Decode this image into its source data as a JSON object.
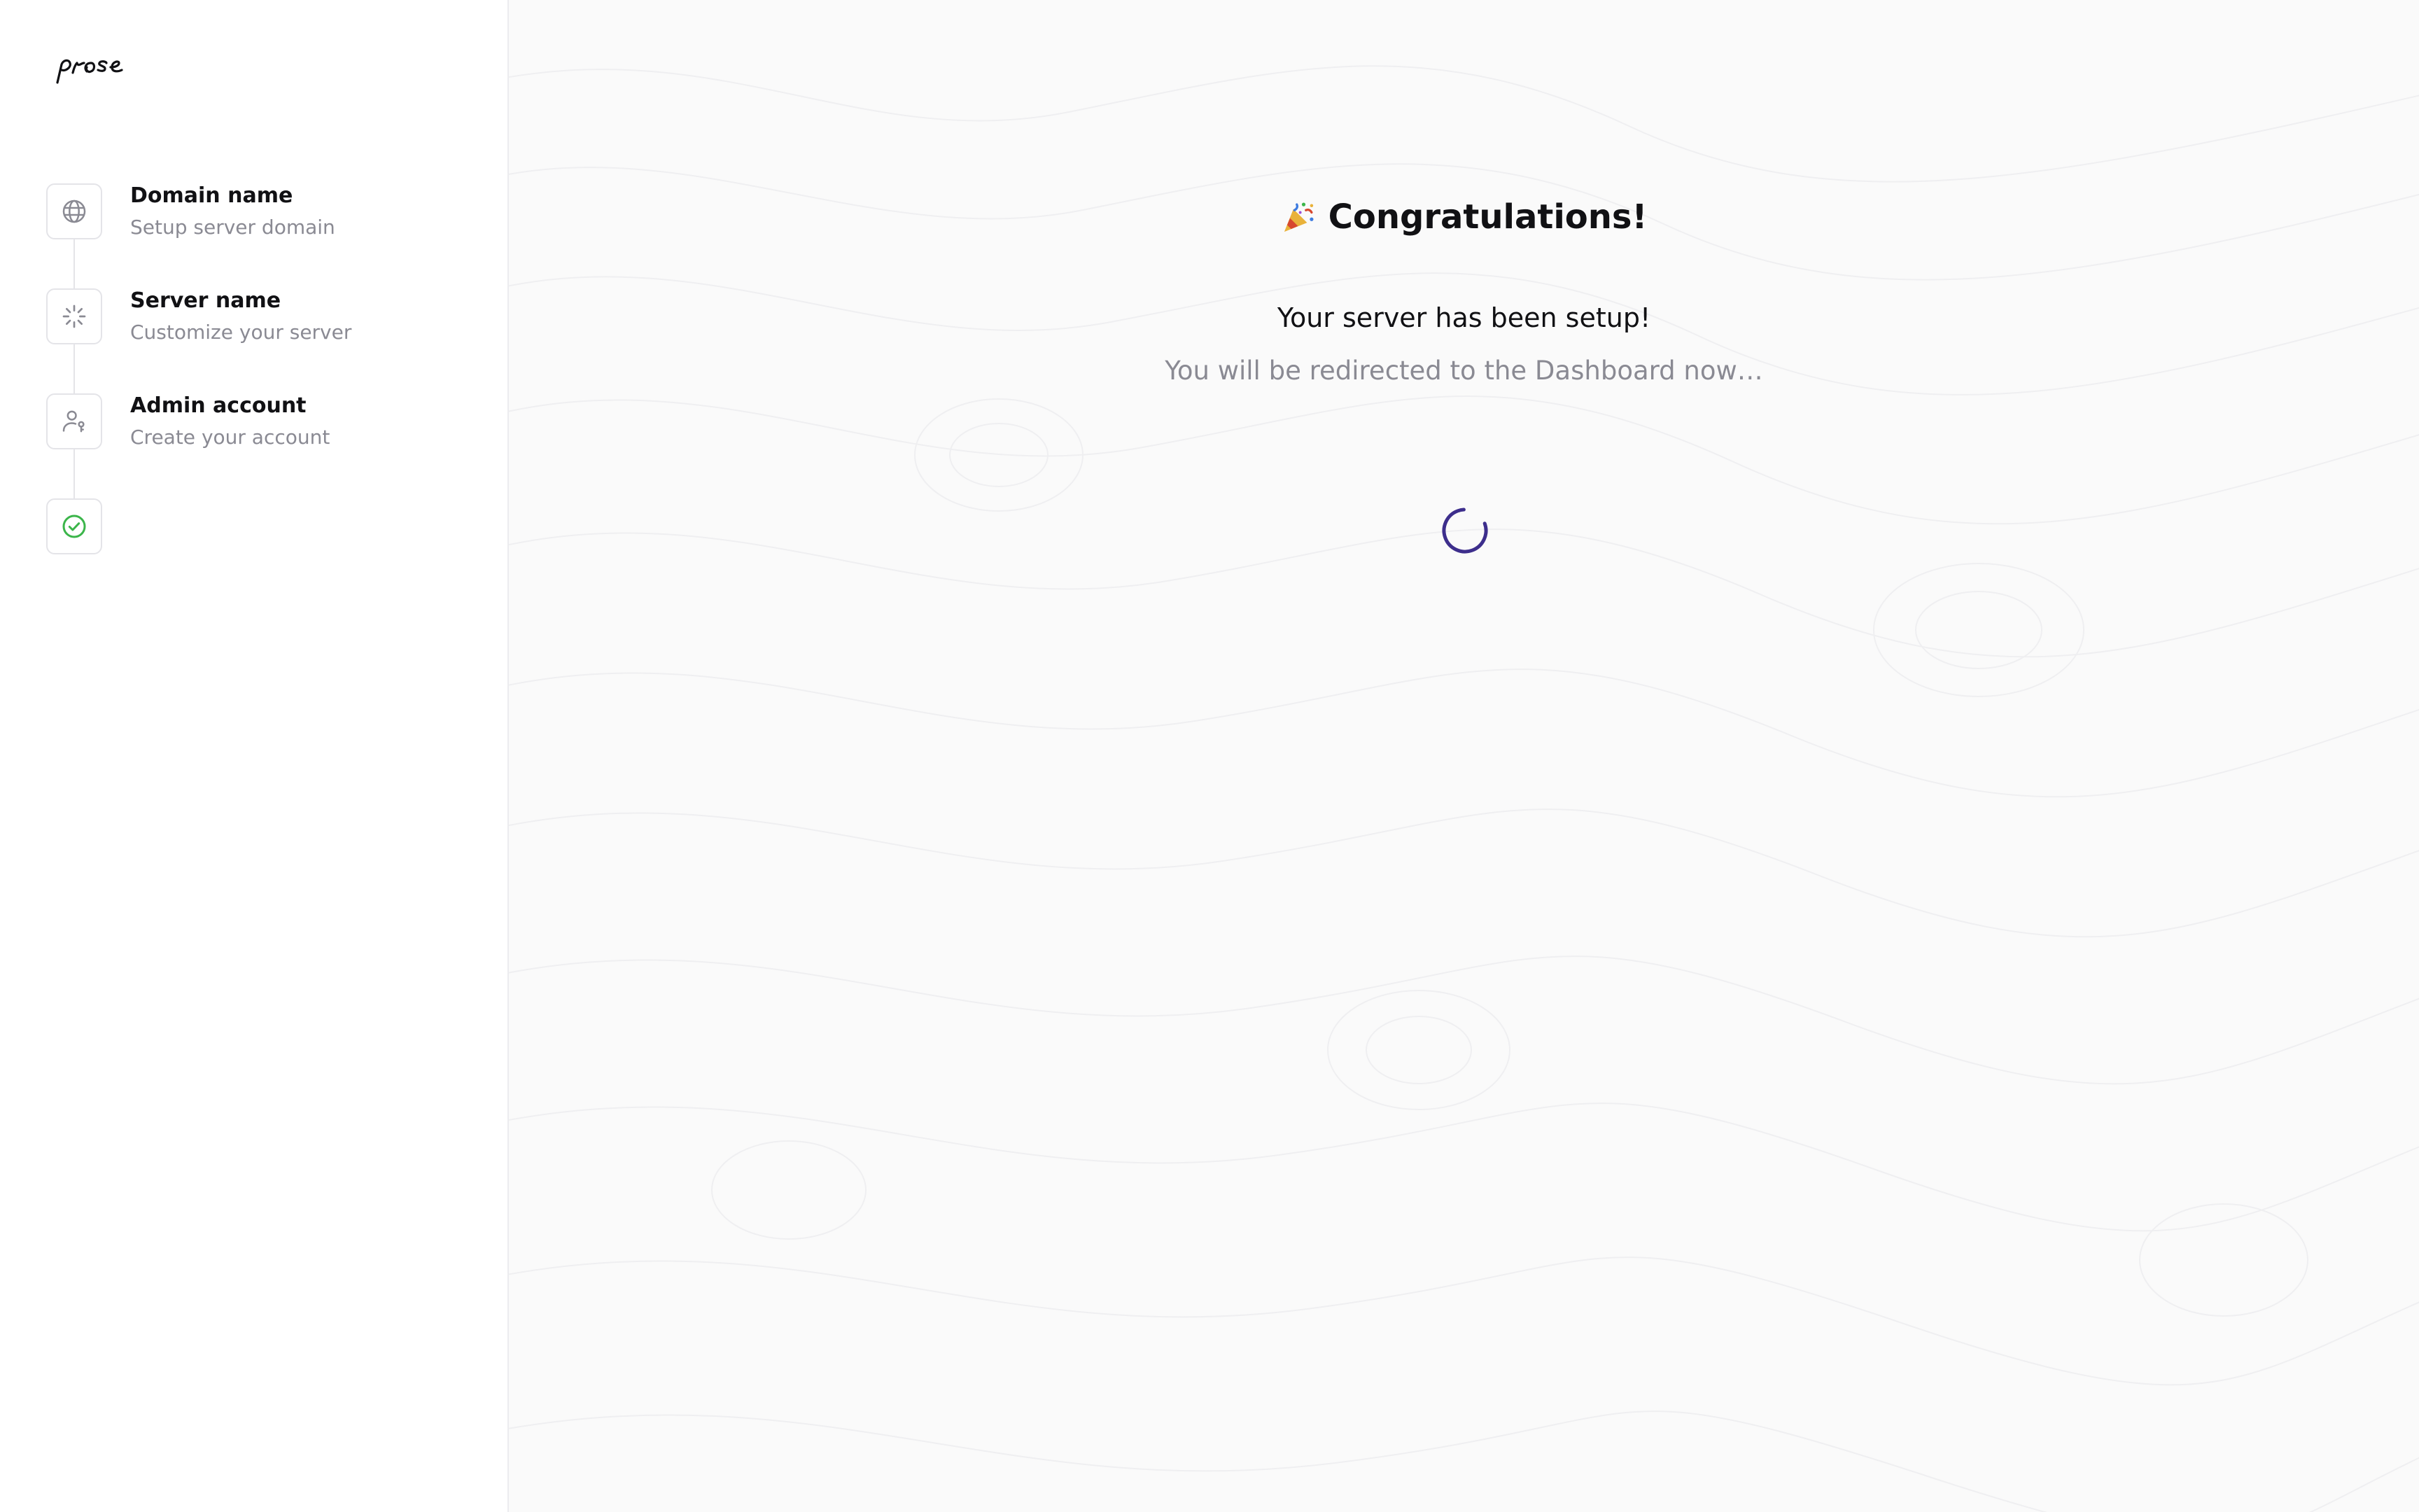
{
  "app": {
    "logo_text": "prose"
  },
  "sidebar": {
    "steps": [
      {
        "title": "Domain name",
        "subtitle": "Setup server domain",
        "icon": "globe-icon"
      },
      {
        "title": "Server name",
        "subtitle": "Customize your server",
        "icon": "loader-icon"
      },
      {
        "title": "Admin account",
        "subtitle": "Create your account",
        "icon": "user-key-icon"
      },
      {
        "title": "",
        "subtitle": "",
        "icon": "check-circle-icon"
      }
    ]
  },
  "main": {
    "heading": "Congratulations!",
    "heading_emoji": "party-popper-icon",
    "message": "Your server has been setup!",
    "redirect_message": "You will be redirected to the Dashboard now…",
    "status": "loading"
  },
  "colors": {
    "spinner": "#3d2e8c",
    "success": "#3bb54a",
    "muted_text": "#8a8a93",
    "text": "#111114"
  }
}
